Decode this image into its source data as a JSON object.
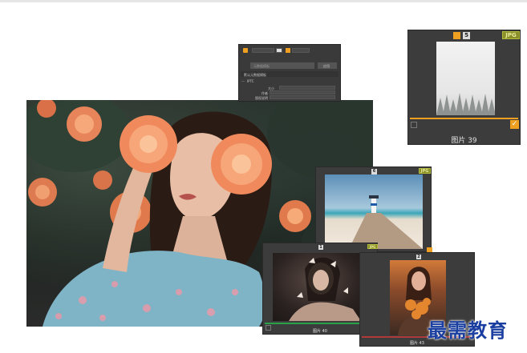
{
  "metadata_panel": {
    "section_label": "IPTC",
    "dropdown_value": "默认元数据模板",
    "search_placeholder": "元数据模板",
    "apply_label": "应用",
    "field_labels": [
      "大小",
      "作者",
      "版权说明"
    ]
  },
  "card_top_right": {
    "badge": "JPG",
    "number": "5",
    "caption": "图片 39"
  },
  "card_mid": {
    "badge": "JPG",
    "number": "6"
  },
  "card_bottom_left": {
    "badge": "JPG",
    "number": "1",
    "caption": "图片 40"
  },
  "card_bottom_right": {
    "number": "2",
    "caption": "图片 43"
  },
  "watermark": "最需教育",
  "colors": {
    "accent": "#f0a020",
    "panel": "#3c3c3c",
    "badge": "#8a8f2a",
    "watermark": "#1a3fa0"
  }
}
